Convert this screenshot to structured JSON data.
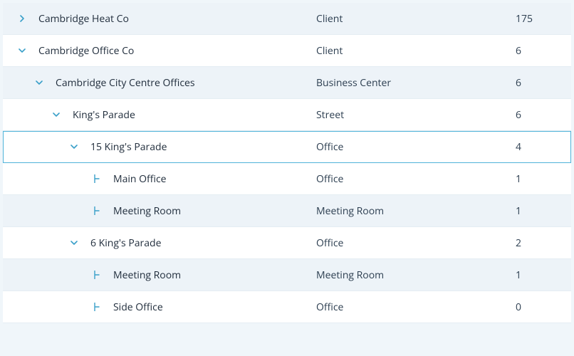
{
  "rows": [
    {
      "name": "Cambridge Heat Co",
      "type": "Client",
      "count": "175",
      "expanded": false,
      "leaf": false,
      "depth": 0,
      "bg": "alt",
      "selected": false
    },
    {
      "name": "Cambridge Office Co",
      "type": "Client",
      "count": "6",
      "expanded": true,
      "leaf": false,
      "depth": 0,
      "bg": "plain",
      "selected": false
    },
    {
      "name": "Cambridge City Centre Offices",
      "type": "Business Center",
      "count": "6",
      "expanded": true,
      "leaf": false,
      "depth": 1,
      "bg": "alt",
      "selected": false
    },
    {
      "name": "King's Parade",
      "type": "Street",
      "count": "6",
      "expanded": true,
      "leaf": false,
      "depth": 2,
      "bg": "plain",
      "selected": false
    },
    {
      "name": "15 King's Parade",
      "type": "Office",
      "count": "4",
      "expanded": true,
      "leaf": false,
      "depth": 3,
      "bg": "plain",
      "selected": true
    },
    {
      "name": "Main Office",
      "type": "Office",
      "count": "1",
      "expanded": false,
      "leaf": true,
      "depth": 4,
      "bg": "plain",
      "selected": false
    },
    {
      "name": "Meeting Room",
      "type": "Meeting Room",
      "count": "1",
      "expanded": false,
      "leaf": true,
      "depth": 4,
      "bg": "alt",
      "selected": false
    },
    {
      "name": "6 King's Parade",
      "type": "Office",
      "count": "2",
      "expanded": true,
      "leaf": false,
      "depth": 3,
      "bg": "plain",
      "selected": false
    },
    {
      "name": "Meeting Room",
      "type": "Meeting Room",
      "count": "1",
      "expanded": false,
      "leaf": true,
      "depth": 4,
      "bg": "alt",
      "selected": false
    },
    {
      "name": "Side Office",
      "type": "Office",
      "count": "0",
      "expanded": false,
      "leaf": true,
      "depth": 4,
      "bg": "plain",
      "selected": false
    }
  ],
  "icons": {
    "chevron_color": "#3aa0c9",
    "leaf_color": "#3aa0c9"
  }
}
